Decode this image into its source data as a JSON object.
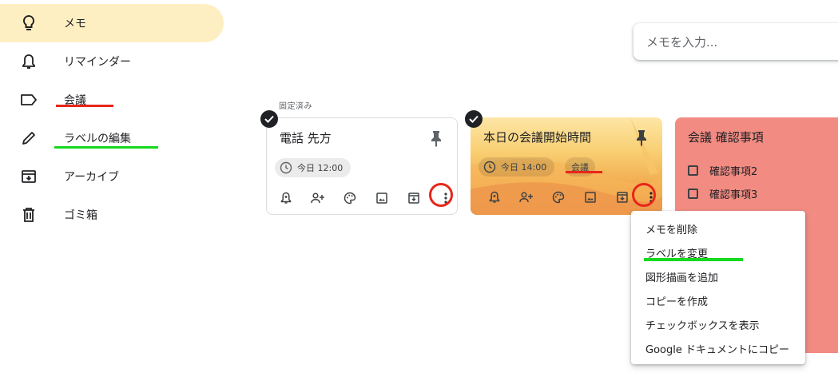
{
  "sidebar": {
    "items": [
      {
        "label": "メモ",
        "icon": "lightbulb-icon",
        "active": true
      },
      {
        "label": "リマインダー",
        "icon": "bell-icon",
        "active": false
      },
      {
        "label": "会議",
        "icon": "label-icon",
        "active": false
      },
      {
        "label": "ラベルの編集",
        "icon": "pencil-icon",
        "active": false
      },
      {
        "label": "アーカイブ",
        "icon": "archive-icon",
        "active": false
      },
      {
        "label": "ゴミ箱",
        "icon": "trash-icon",
        "active": false
      }
    ]
  },
  "search": {
    "placeholder": "メモを入力..."
  },
  "pinned_section": {
    "label": "固定済み"
  },
  "notes": [
    {
      "title": "電話 先方",
      "reminder": "今日 12:00"
    },
    {
      "title": "本日の会議開始時間",
      "reminder": "今日 14:00",
      "label": "会議"
    },
    {
      "title": "会議 確認事項",
      "checklist": [
        "確認事項2",
        "確認事項3"
      ]
    }
  ],
  "context_menu": {
    "items": [
      "メモを削除",
      "ラベルを変更",
      "図形描画を追加",
      "コピーを作成",
      "チェックボックスを表示",
      "Google ドキュメントにコピー"
    ]
  },
  "colors": {
    "active_sidebar": "#feefc3",
    "highlight_red": "#e8261a",
    "highlight_green": "#15d91e",
    "note3_bg": "#f28b82"
  }
}
